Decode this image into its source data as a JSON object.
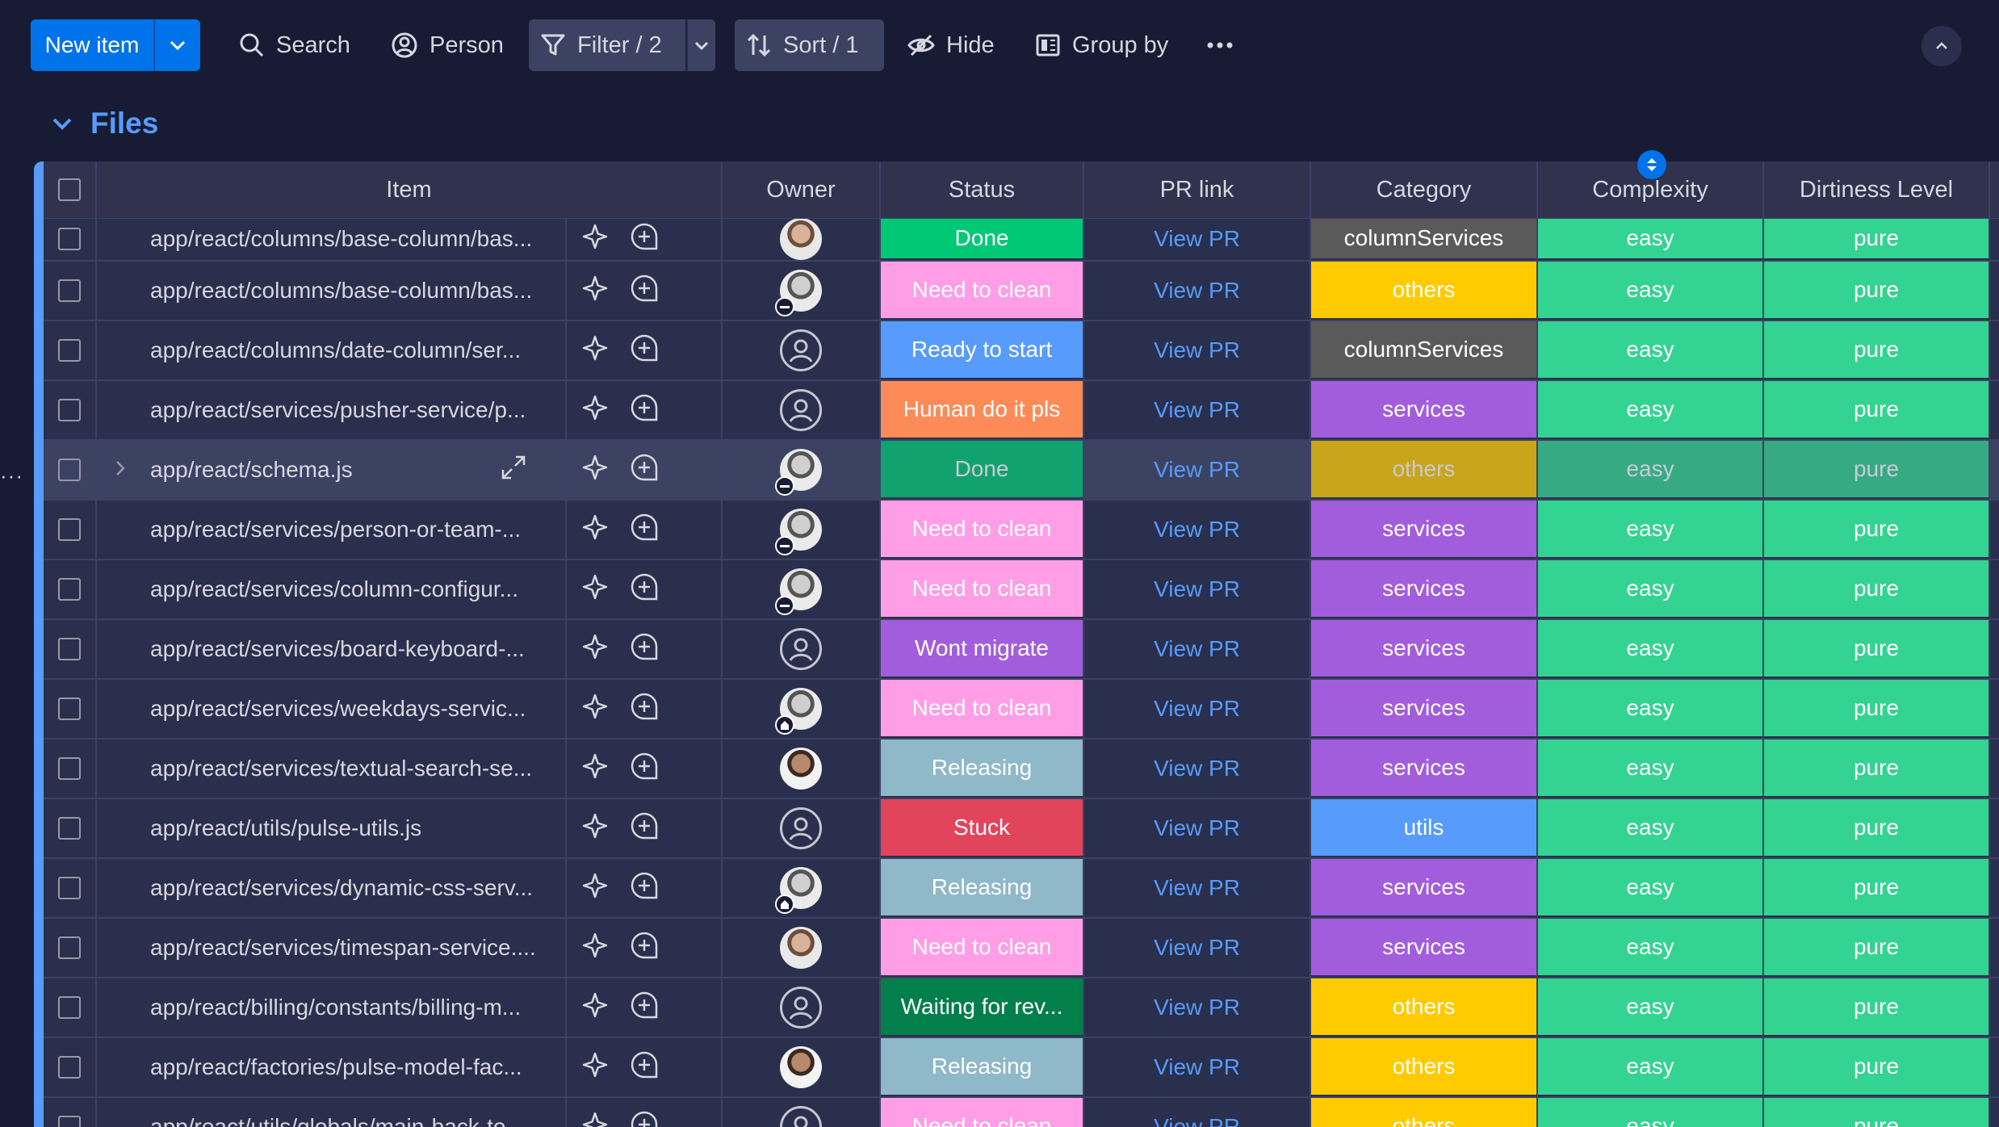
{
  "toolbar": {
    "new_item": "New item",
    "search": "Search",
    "person": "Person",
    "filter": "Filter / 2",
    "sort": "Sort / 1",
    "hide": "Hide",
    "group_by": "Group by"
  },
  "group": {
    "title": "Files",
    "color": "#579bfc"
  },
  "columns": {
    "item": "Item",
    "owner": "Owner",
    "status": "Status",
    "pr_link": "PR link",
    "category": "Category",
    "complexity": "Complexity",
    "dirtiness": "Dirtiness Level"
  },
  "status_colors": {
    "Done": "#00c875",
    "Need to clean": "#ff9ee6",
    "Ready to start": "#579bfc",
    "Human do it pls": "#fd8b58",
    "Wont migrate": "#a25ddc",
    "Releasing": "#8fb8c8",
    "Stuck": "#e2445c",
    "Waiting for rev...": "#037f4c"
  },
  "category_colors": {
    "columnServices": "#5a5a5a",
    "others": "#ffcb00",
    "services": "#a25ddc",
    "utils": "#579bfc"
  },
  "complexity_color": "#33d391",
  "dirtiness_color": "#33d391",
  "rows": [
    {
      "item": "app/react/columns/base-column/bas...",
      "owner": "photo",
      "status": "Done",
      "pr": "View PR",
      "category": "columnServices",
      "complexity": "easy",
      "dirtiness": "pure"
    },
    {
      "item": "app/react/columns/base-column/bas...",
      "owner": "gray-minus",
      "status": "Need to clean",
      "pr": "View PR",
      "category": "others",
      "complexity": "easy",
      "dirtiness": "pure"
    },
    {
      "item": "app/react/columns/date-column/ser...",
      "owner": "empty",
      "status": "Ready to start",
      "pr": "View PR",
      "category": "columnServices",
      "complexity": "easy",
      "dirtiness": "pure"
    },
    {
      "item": "app/react/services/pusher-service/p...",
      "owner": "empty",
      "status": "Human do it pls",
      "pr": "View PR",
      "category": "services",
      "complexity": "easy",
      "dirtiness": "pure"
    },
    {
      "item": "app/react/schema.js",
      "owner": "gray-minus",
      "status": "Done",
      "pr": "View PR",
      "category": "others",
      "complexity": "easy",
      "dirtiness": "pure",
      "highlight": true
    },
    {
      "item": "app/react/services/person-or-team-...",
      "owner": "gray-minus",
      "status": "Need to clean",
      "pr": "View PR",
      "category": "services",
      "complexity": "easy",
      "dirtiness": "pure"
    },
    {
      "item": "app/react/services/column-configur...",
      "owner": "gray-minus",
      "status": "Need to clean",
      "pr": "View PR",
      "category": "services",
      "complexity": "easy",
      "dirtiness": "pure"
    },
    {
      "item": "app/react/services/board-keyboard-...",
      "owner": "empty",
      "status": "Wont migrate",
      "pr": "View PR",
      "category": "services",
      "complexity": "easy",
      "dirtiness": "pure"
    },
    {
      "item": "app/react/services/weekdays-servic...",
      "owner": "gray-home",
      "status": "Need to clean",
      "pr": "View PR",
      "category": "services",
      "complexity": "easy",
      "dirtiness": "pure"
    },
    {
      "item": "app/react/services/textual-search-se...",
      "owner": "dark",
      "status": "Releasing",
      "pr": "View PR",
      "category": "services",
      "complexity": "easy",
      "dirtiness": "pure"
    },
    {
      "item": "app/react/utils/pulse-utils.js",
      "owner": "empty",
      "status": "Stuck",
      "pr": "View PR",
      "category": "utils",
      "complexity": "easy",
      "dirtiness": "pure"
    },
    {
      "item": "app/react/services/dynamic-css-serv...",
      "owner": "gray-home",
      "status": "Releasing",
      "pr": "View PR",
      "category": "services",
      "complexity": "easy",
      "dirtiness": "pure"
    },
    {
      "item": "app/react/services/timespan-service....",
      "owner": "photo",
      "status": "Need to clean",
      "pr": "View PR",
      "category": "services",
      "complexity": "easy",
      "dirtiness": "pure"
    },
    {
      "item": "app/react/billing/constants/billing-m...",
      "owner": "empty",
      "status": "Waiting for rev...",
      "pr": "View PR",
      "category": "others",
      "complexity": "easy",
      "dirtiness": "pure"
    },
    {
      "item": "app/react/factories/pulse-model-fac...",
      "owner": "dark",
      "status": "Releasing",
      "pr": "View PR",
      "category": "others",
      "complexity": "easy",
      "dirtiness": "pure"
    },
    {
      "item": "app/react/utils/globals/main-back-to...",
      "owner": "empty",
      "status": "Need to clean",
      "pr": "View PR",
      "category": "others",
      "complexity": "easy",
      "dirtiness": "pure"
    }
  ]
}
